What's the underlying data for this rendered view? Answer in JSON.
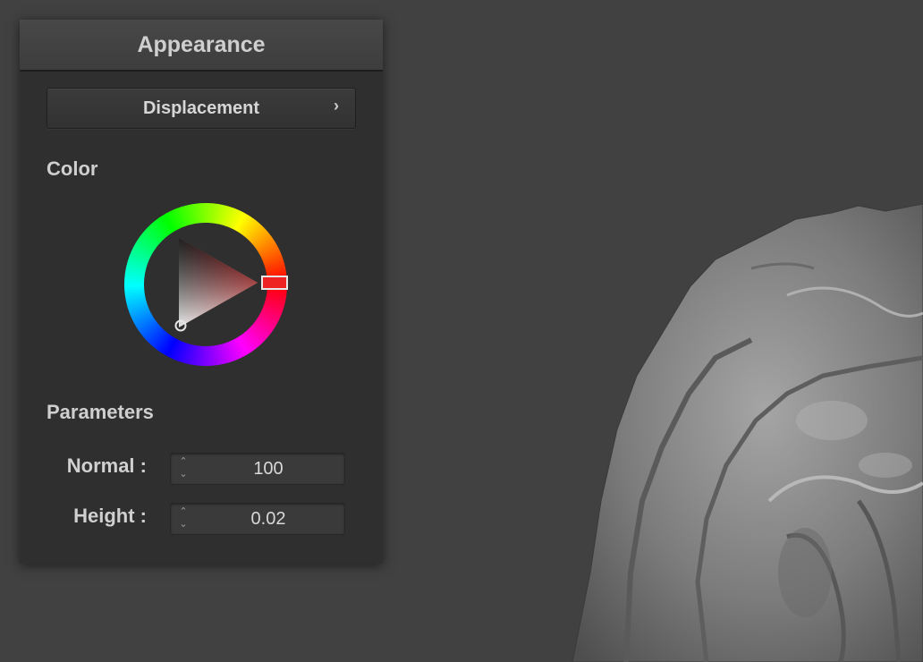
{
  "panel": {
    "title": "Appearance",
    "displacement_button": {
      "label": "Displacement",
      "chevron": "›"
    },
    "color_section": {
      "title": "Color",
      "selected_hue": "#ff0000"
    },
    "parameters_section": {
      "title": "Parameters",
      "fields": [
        {
          "label": "Normal :",
          "value": "100"
        },
        {
          "label": "Height :",
          "value": "0.02"
        }
      ]
    }
  },
  "spin_arrows": {
    "up": "⌃",
    "down": "⌄"
  },
  "colors": {
    "viewport_bg": "#414141",
    "panel_bg": "#2f2f2f",
    "mesh": "#8a8a8a"
  }
}
